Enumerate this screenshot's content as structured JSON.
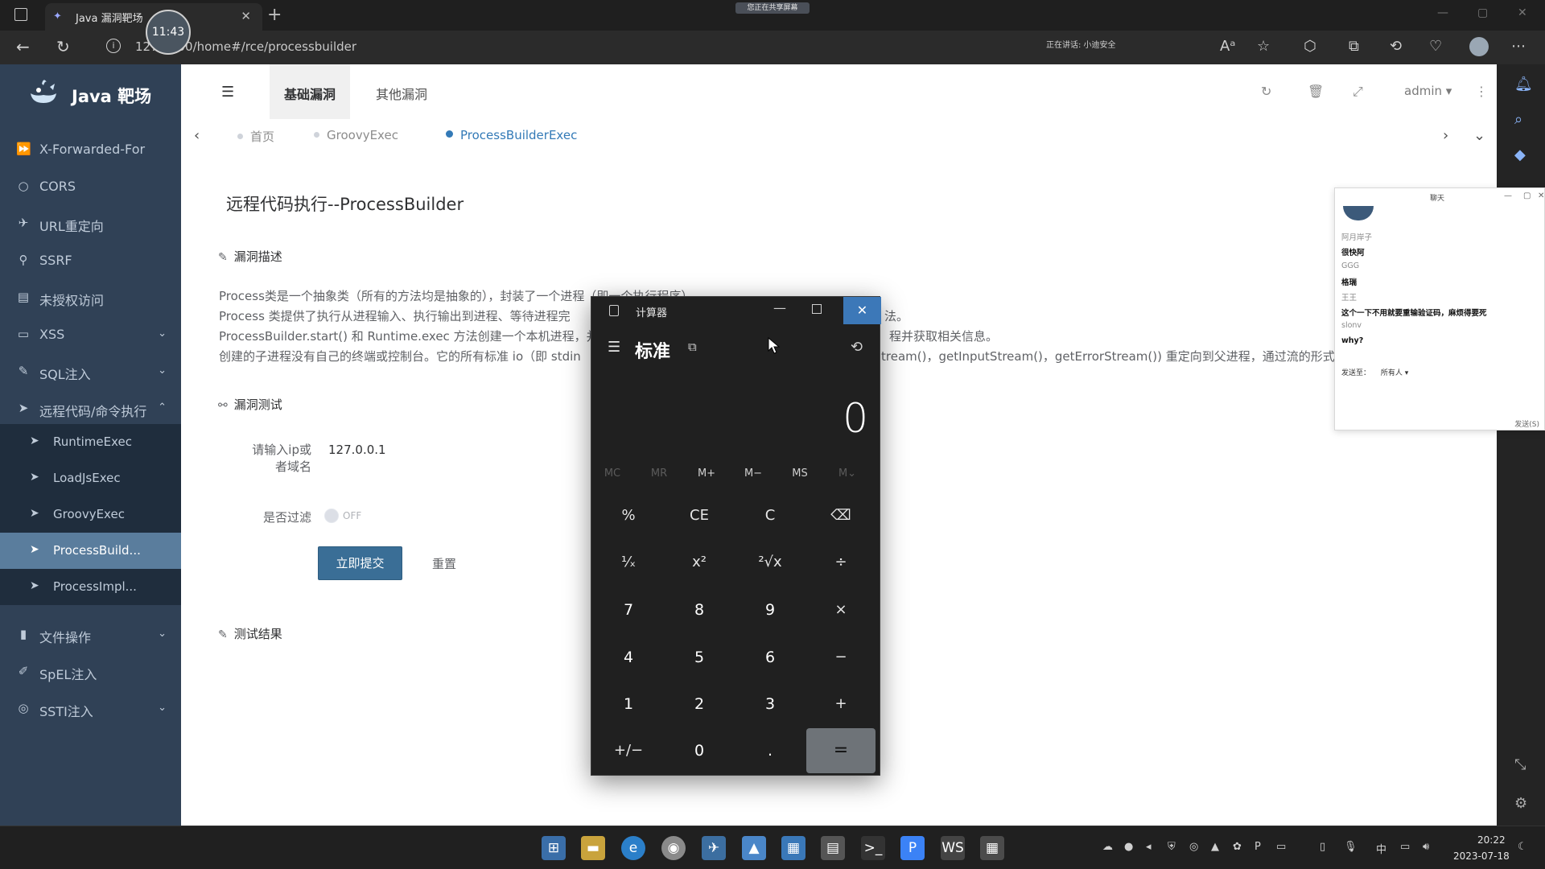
{
  "browser": {
    "tab_title": "Java 漏洞靶场",
    "url": "127.0.0.1:8000/home#/rce/processbuilder",
    "url_visible": "127  8000/home#/rce/processbuilder",
    "share_banner": "您正在共享屏幕",
    "talk_status": "正在讲话: 小迪安全",
    "clock_overlay": "11:43"
  },
  "brand": {
    "title": "Java 靶场"
  },
  "sidebar": {
    "items": [
      {
        "label": "X-Forwarded-For",
        "icon": "forward-icon"
      },
      {
        "label": "CORS",
        "icon": "circle-icon"
      },
      {
        "label": "URL重定向",
        "icon": "redirect-icon"
      },
      {
        "label": "SSRF",
        "icon": "tool-icon"
      },
      {
        "label": "未授权访问",
        "icon": "id-card-icon"
      },
      {
        "label": "XSS",
        "icon": "monitor-icon"
      },
      {
        "label": "SQL注入",
        "icon": "edit-icon"
      },
      {
        "label": "远程代码/命令执行",
        "icon": "pointer-icon"
      },
      {
        "label": "文件操作",
        "icon": "file-icon"
      },
      {
        "label": "SpEL注入",
        "icon": "pen-icon"
      },
      {
        "label": "SSTI注入",
        "icon": "chrome-icon"
      }
    ],
    "rce_submenu": [
      "RuntimeExec",
      "LoadJsExec",
      "GroovyExec",
      "ProcessBuild...",
      "ProcessImpl..."
    ],
    "active_submenu": "ProcessBuild..."
  },
  "topnav": {
    "tabs": [
      "基础漏洞",
      "其他漏洞"
    ],
    "active_tab": "基础漏洞",
    "user": "admin"
  },
  "tags": [
    "首页",
    "GroovyExec",
    "ProcessBuilderExec"
  ],
  "active_tag": "ProcessBuilderExec",
  "page": {
    "title": "远程代码执行--ProcessBuilder",
    "section_desc": "漏洞描述",
    "desc_lines": [
      "Process类是一个抽象类（所有的方法均是抽象的），封装了一个进程（即一个执行程序）。",
      "Process 类提供了执行从进程输入、执行输出到进程、等待进程完",
      "ProcessBuilder.start() 和 Runtime.exec 方法创建一个本机进程，并",
      "创建的子进程没有自己的终端或控制台。它的所有标准 io（即 stdin",
      "法。",
      "程并获取相关信息。",
      "tream()，getInputStream()，getErrorStream()) 重定向到父进程，通过流的形式进"
    ],
    "section_test": "漏洞测试",
    "ip_label_line1": "请输入ip或",
    "ip_label_line2": "者域名",
    "ip_value": "127.0.0.1",
    "filter_label": "是否过滤",
    "filter_state": "OFF",
    "submit_label": "立即提交",
    "reset_label": "重置",
    "section_result": "测试结果"
  },
  "calculator": {
    "title": "计算器",
    "mode": "标准",
    "display": "0",
    "memory": [
      "MC",
      "MR",
      "M+",
      "M−",
      "MS",
      "M⌄"
    ],
    "keys": [
      [
        "%",
        "CE",
        "C",
        "⌫"
      ],
      [
        "¹⁄ₓ",
        "x²",
        "²√x",
        "÷"
      ],
      [
        "7",
        "8",
        "9",
        "×"
      ],
      [
        "4",
        "5",
        "6",
        "−"
      ],
      [
        "1",
        "2",
        "3",
        "+"
      ],
      [
        "+/−",
        "0",
        ".",
        "="
      ]
    ]
  },
  "chat": {
    "title": "聊天",
    "lines": [
      {
        "text": "阿月岸子",
        "kind": "name"
      },
      {
        "text": "很快阿",
        "kind": "msg"
      },
      {
        "text": "GGG",
        "kind": "name"
      },
      {
        "text": "格瑞",
        "kind": "msg"
      },
      {
        "text": "王王",
        "kind": "name"
      },
      {
        "text": "这个一下不用就要重输验证码，麻烦得要死",
        "kind": "msg"
      },
      {
        "text": "slonv",
        "kind": "name"
      },
      {
        "text": "why?",
        "kind": "msg"
      }
    ],
    "send_to_label": "发送至：",
    "send_to_value": "所有人",
    "send_button": "发送(S)"
  },
  "tray": {
    "time": "20:22",
    "date": "2023-07-18",
    "ime": "中"
  }
}
